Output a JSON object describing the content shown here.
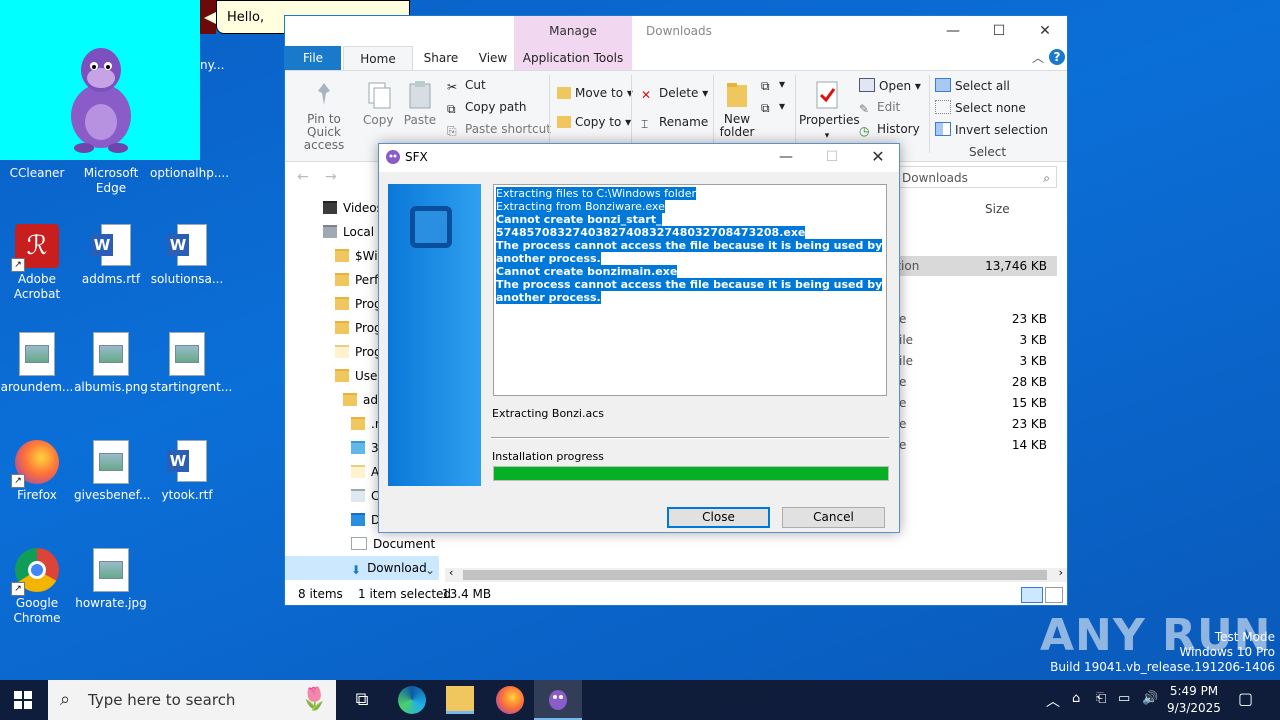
{
  "bonzi": {
    "speech": "Hello,"
  },
  "desktop": {
    "icons": [
      {
        "label": "CCleaner"
      },
      {
        "label": "Microsoft Edge"
      },
      {
        "label": "optionalhp...."
      },
      {
        "label": "Adobe Acrobat"
      },
      {
        "label": "addms.rtf"
      },
      {
        "label": "solutionsa..."
      },
      {
        "label": "aroundem..."
      },
      {
        "label": "albumis.png"
      },
      {
        "label": "startingrent..."
      },
      {
        "label": "Firefox"
      },
      {
        "label": "givesbenef..."
      },
      {
        "label": "ytook.rtf"
      },
      {
        "label": "Google Chrome"
      },
      {
        "label": "howrate.jpg"
      }
    ],
    "partial_label": "ny..."
  },
  "explorer": {
    "context_tab": "Manage",
    "title": "Downloads",
    "tabs": {
      "file": "File",
      "home": "Home",
      "share": "Share",
      "view": "View",
      "apptools": "Application Tools"
    },
    "ribbon": {
      "pin": "Pin to Quick access",
      "copy": "Copy",
      "paste": "Paste",
      "cut": "Cut",
      "copy_path": "Copy path",
      "paste_shortcut": "Paste shortcut",
      "move_to": "Move to",
      "copy_to": "Copy to",
      "delete": "Delete",
      "rename": "Rename",
      "new_folder": "New folder",
      "properties": "Properties",
      "open": "Open",
      "edit": "Edit",
      "history": "History",
      "select_all": "Select all",
      "select_none": "Select none",
      "invert_selection": "Invert selection",
      "select_group": "Select"
    },
    "search_placeholder": "Downloads",
    "column_size": "Size",
    "nav": [
      "Videos",
      "Local D",
      "$Win",
      "PerfL",
      "Prog",
      "Prog",
      "Prog",
      "Users",
      "adm",
      ".m",
      "3D",
      "A",
      "C",
      "D",
      "Document",
      "Download"
    ],
    "rows": [
      {
        "type_fragment": "ation",
        "size": "13,746 KB",
        "selected": true
      },
      {
        "type_fragment": "e",
        "size": "23 KB"
      },
      {
        "type_fragment": "ile",
        "size": "3 KB"
      },
      {
        "type_fragment": "ile",
        "size": "3 KB"
      },
      {
        "type_fragment": "e",
        "size": "28 KB"
      },
      {
        "type_fragment": "e",
        "size": "15 KB"
      },
      {
        "type_fragment": "e",
        "size": "23 KB"
      },
      {
        "type_fragment": "e",
        "size": "14 KB"
      }
    ],
    "status": {
      "items": "8 items",
      "selected": "1 item selected",
      "size": "13.4 MB"
    }
  },
  "sfx": {
    "title": "SFX",
    "log": [
      {
        "text": "Extracting files to C:\\Windows folder",
        "bold": false
      },
      {
        "text": "Extracting from Bonziware.exe",
        "bold": false
      },
      {
        "text": "Cannot create bonzi_start_",
        "bold": true
      },
      {
        "text": "5748570832740382740832748032708473208.exe",
        "bold": true
      },
      {
        "text": "The process cannot access the file because it is being used by another process.",
        "bold": true
      },
      {
        "text": "Cannot create bonzimain.exe",
        "bold": true
      },
      {
        "text": "The process cannot access the file because it is being used by another process.",
        "bold": true
      }
    ],
    "current_file": "Extracting Bonzi.acs",
    "progress_label": "Installation progress",
    "progress": 1.0,
    "close_label": "Close",
    "cancel_label": "Cancel",
    "accent": "#06b025"
  },
  "taskbar": {
    "search_placeholder": "Type here to search",
    "time": "5:49 PM",
    "date": "9/3/2025"
  },
  "watermark": "ANY RUN",
  "test_mode": {
    "line1": "Test Mode",
    "line2": "Windows 10 Pro",
    "line3": "Build 19041.vb_release.191206-1406"
  }
}
